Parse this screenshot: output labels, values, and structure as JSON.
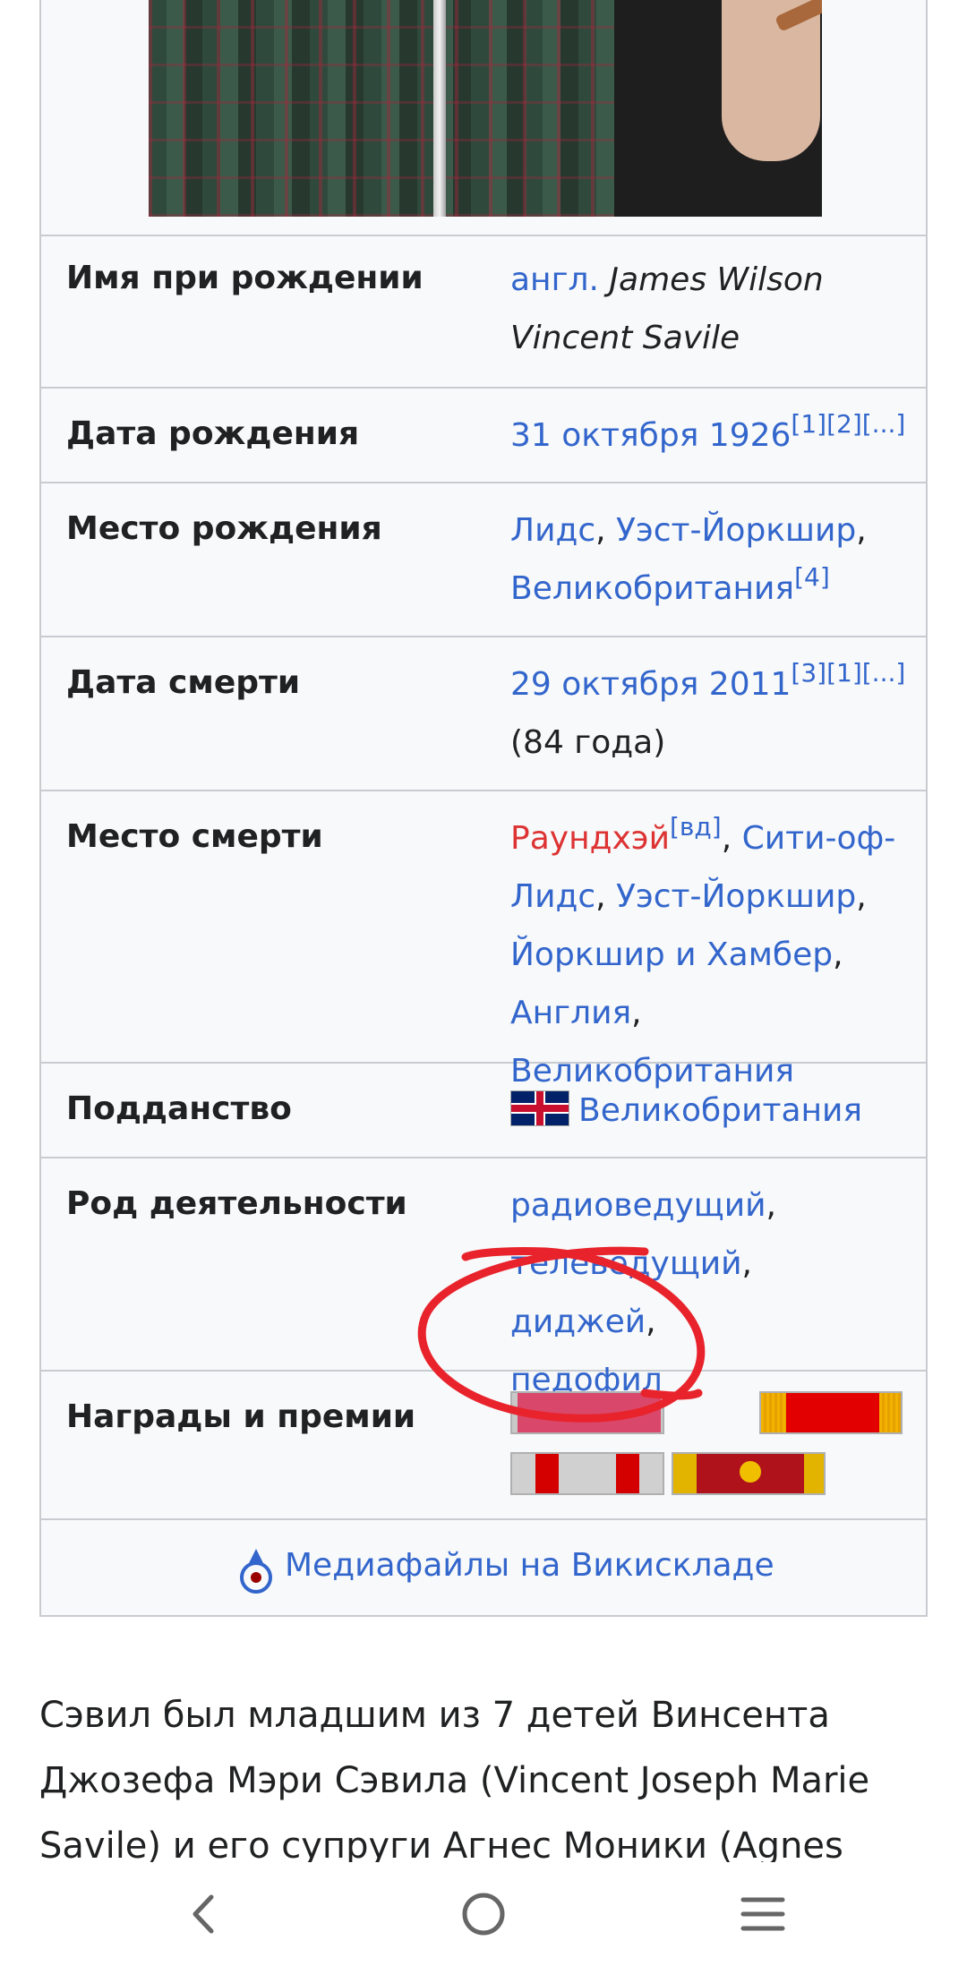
{
  "infobox": {
    "rows": [
      {
        "label": "Имя при рождении",
        "prefix": "англ.",
        "value": "James Wilson Vincent Savile"
      },
      {
        "label": "Дата рождения",
        "value": "31 октября 1926",
        "refs": "[1][2][...]"
      },
      {
        "label": "Место рождения",
        "link1": "Лидс",
        "link2": "Уэст-Йоркшир",
        "link3": "Великобритания",
        "refs": "[4]"
      },
      {
        "label": "Дата смерти",
        "value": "29 октября 2011",
        "refs": "[3][1][...]",
        "age": "(84 года)"
      },
      {
        "label": "Место смерти",
        "redlink": "Раундхэй",
        "redref": "[вд]",
        "link1": "Сити-оф-Лидс",
        "link2": "Уэст-Йоркшир",
        "link3": "Йоркшир и Хамбер",
        "link4": "Англия",
        "link5": "Великобритания"
      },
      {
        "label": "Подданство",
        "value": "Великобритания",
        "flag_icon": "uk-flag-icon"
      },
      {
        "label": "Род деятельности",
        "occ1": "радиоведущий",
        "occ2": "телеведущий",
        "occ3": "диджей",
        "occ4": "педофил"
      },
      {
        "label": "Награды и премии"
      }
    ],
    "commons": "Медиафайлы на Викискладе"
  },
  "paragraph": "Сэвил был младшим из 7 детей Винсента Джозефа Мэри Сэвила (Vincent Joseph Marie Savile) и его супруги Агнес Моники (Agnes Monica).",
  "colors": {
    "link": "#3366cc",
    "redlink": "#d33",
    "annotation": "#e8232c"
  },
  "navbar": {
    "back_icon": "chevron-left-icon",
    "home_icon": "circle-icon",
    "menu_icon": "menu-icon"
  }
}
